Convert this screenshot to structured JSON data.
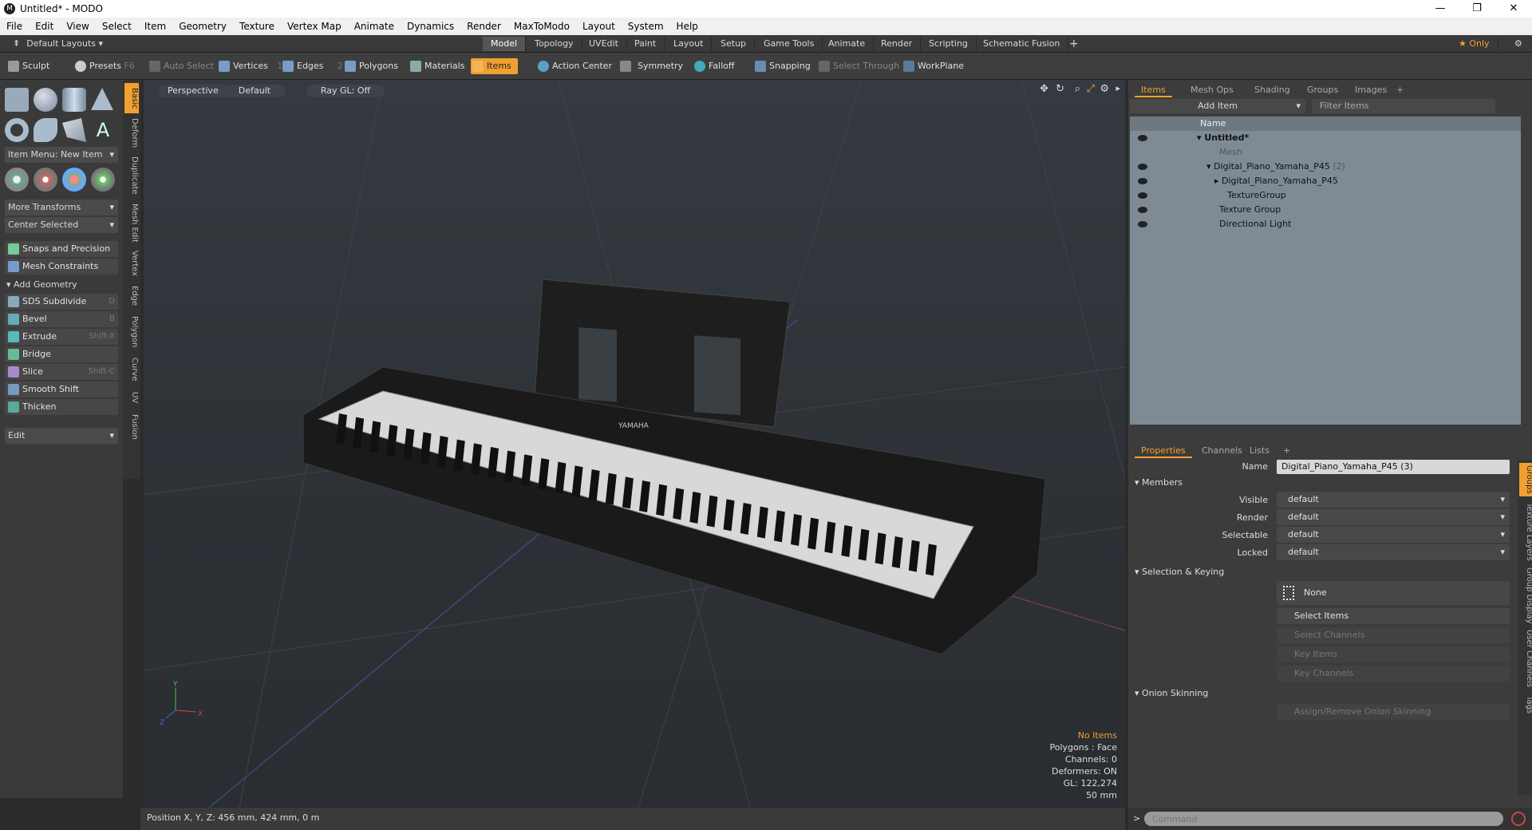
{
  "window": {
    "title": "Untitled* - MODO",
    "logo": "M",
    "controls": [
      "—",
      "❐",
      "✕"
    ]
  },
  "menu": [
    "File",
    "Edit",
    "View",
    "Select",
    "Item",
    "Geometry",
    "Texture",
    "Vertex Map",
    "Animate",
    "Dynamics",
    "Render",
    "MaxToModo",
    "Layout",
    "System",
    "Help"
  ],
  "layout": {
    "preset": "Default Layouts ▾",
    "tabs": [
      "Model",
      "Topology",
      "UVEdit",
      "Paint",
      "Layout",
      "Setup",
      "Game Tools",
      "Animate",
      "Render",
      "Scripting",
      "Schematic Fusion"
    ],
    "active": "Model",
    "only": "★ Only"
  },
  "toolbar": {
    "sculpt": "Sculpt",
    "presets": "Presets",
    "presets_key": "F6",
    "auto_select": "Auto Select",
    "vertices": "Vertices",
    "vertices_n": "1",
    "edges": "Edges",
    "edges_n": "2",
    "polygons": "Polygons",
    "materials": "Materials",
    "items": "Items",
    "action_center": "Action Center",
    "symmetry": "Symmetry",
    "falloff": "Falloff",
    "snapping": "Snapping",
    "select_through": "Select Through",
    "workplane": "WorkPlane"
  },
  "left": {
    "item_menu": "Item Menu: New Item",
    "more_transforms": "More Transforms",
    "center_selected": "Center Selected",
    "snaps": "Snaps and Precision",
    "mesh_constraints": "Mesh Constraints",
    "add_geometry": "Add Geometry",
    "tools": [
      {
        "label": "SDS Subdivide",
        "key": "D"
      },
      {
        "label": "Bevel",
        "key": "B"
      },
      {
        "label": "Extrude",
        "key": "Shift-X"
      },
      {
        "label": "Bridge",
        "key": ""
      },
      {
        "label": "Slice",
        "key": "Shift-C"
      },
      {
        "label": "Smooth Shift",
        "key": ""
      },
      {
        "label": "Thicken",
        "key": ""
      }
    ],
    "edit": "Edit",
    "vtabs": [
      "Basic",
      "Deform",
      "Duplicate",
      "Mesh Edit",
      "Vertex",
      "Edge",
      "Polygon",
      "Curve",
      "UV",
      "Fusion"
    ]
  },
  "viewport": {
    "view": "Perspective",
    "shading": "Default",
    "raygl": "Ray GL: Off",
    "brand": "YAMAHA",
    "info": {
      "items": "No Items",
      "polygons": "Polygons : Face",
      "channels": "Channels: 0",
      "deformers": "Deformers: ON",
      "gl": "GL: 122,274",
      "scale": "50 mm"
    },
    "axis": {
      "x": "X",
      "y": "Y",
      "z": "Z"
    }
  },
  "status": {
    "position": "Position X, Y, Z:  456 mm, 424 mm, 0 m"
  },
  "items_panel": {
    "tabs": [
      "Items",
      "Mesh Ops",
      "Shading",
      "Groups",
      "Images",
      "+"
    ],
    "add_item": "Add Item",
    "filter": "Filter Items",
    "col_name": "Name",
    "rows": [
      {
        "label": "Untitled*",
        "indent": 0
      },
      {
        "label": "Mesh",
        "indent": 1
      },
      {
        "label": "Digital_Piano_Yamaha_P45",
        "suffix": " (2)",
        "indent": 1
      },
      {
        "label": "Digital_Piano_Yamaha_P45",
        "indent": 2
      },
      {
        "label": "TextureGroup",
        "indent": 2
      },
      {
        "label": "Texture Group",
        "indent": 1
      },
      {
        "label": "Directional Light",
        "indent": 1
      }
    ]
  },
  "props_panel": {
    "tabs": [
      "Properties",
      "Channels",
      "Lists",
      "+"
    ],
    "name_label": "Name",
    "name_value": "Digital_Piano_Yamaha_P45 (3)",
    "members": "Members",
    "fields": [
      {
        "label": "Visible",
        "value": "default"
      },
      {
        "label": "Render",
        "value": "default"
      },
      {
        "label": "Selectable",
        "value": "default"
      },
      {
        "label": "Locked",
        "value": "default"
      }
    ],
    "selection_keying": "Selection & Keying",
    "none": "None",
    "select_items": "Select Items",
    "select_channels": "Select Channels",
    "key_items": "Key Items",
    "key_channels": "Key Channels",
    "onion": "Onion Skinning",
    "onion_btn": "Assign/Remove Onion Skinning",
    "rtabs": [
      "Groups",
      "Texture Layers",
      "Group Display",
      "User Channels",
      "Tags"
    ]
  },
  "command": {
    "placeholder": "Command"
  },
  "colors": {
    "accent": "#f0a030"
  }
}
